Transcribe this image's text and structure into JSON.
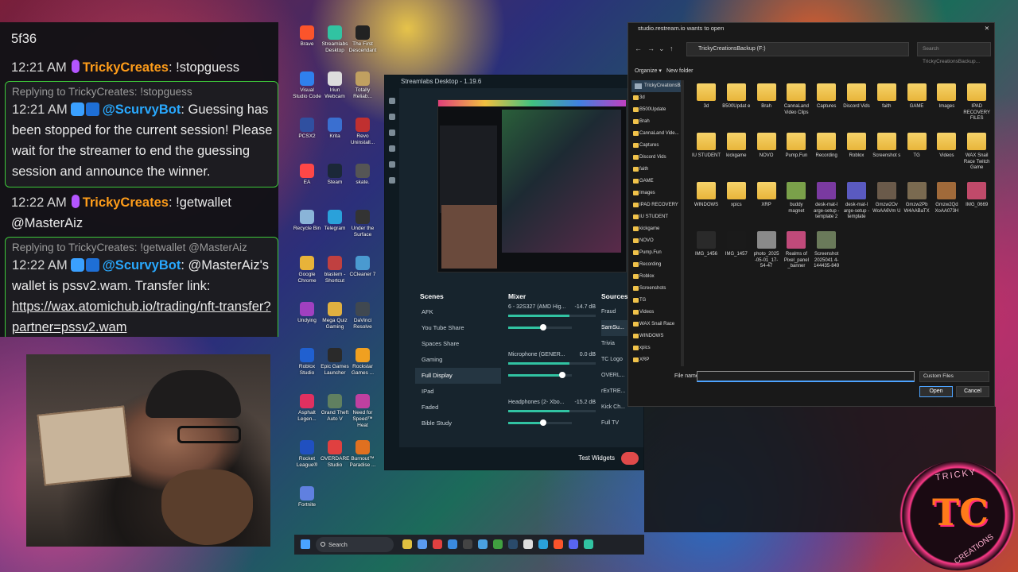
{
  "chat": {
    "top_fragment": "5f36",
    "messages": [
      {
        "type": "msg",
        "time": "12:21 AM",
        "user": "TrickyCreates",
        "text": ": !stopguess"
      },
      {
        "type": "reply",
        "reply_to": "Replying to TrickyCreates: !stopguess",
        "time": "12:21 AM",
        "user": "@ScurvyBot",
        "text": ": Guessing has been stopped for the current session! Please wait for the streamer to end the guessing session and announce the winner."
      },
      {
        "type": "msg",
        "time": "12:22 AM",
        "user": "TrickyCreates",
        "text": ": !getwallet @MasterAiz"
      },
      {
        "type": "reply",
        "reply_to": "Replying to TrickyCreates: !getwallet @MasterAiz",
        "time": "12:22 AM",
        "user": "@ScurvyBot",
        "text": ": @MasterAiz's wallet is pssv2.wam. Transfer link:",
        "link": "https://wax.atomichub.io/trading/nft-transfer?partner=pssv2.wam"
      }
    ]
  },
  "desktop_icons": [
    {
      "label": "Brave",
      "color": "#fb542b"
    },
    {
      "label": "Streamlabs Desktop",
      "color": "#31c3a2"
    },
    {
      "label": "The First Descendant",
      "color": "#222222"
    },
    {
      "label": "Visual Studio Code",
      "color": "#2f80ed"
    },
    {
      "label": "Iriun Webcam",
      "color": "#dddddd"
    },
    {
      "label": "Totally Reliab...",
      "color": "#c0a060"
    },
    {
      "label": "PCSX2",
      "color": "#3050a0"
    },
    {
      "label": "Krita",
      "color": "#3a6fd0"
    },
    {
      "label": "Revo Uninstall...",
      "color": "#c03030"
    },
    {
      "label": "EA",
      "color": "#ff4747"
    },
    {
      "label": "Steam",
      "color": "#1b2838"
    },
    {
      "label": "skate.",
      "color": "#555555"
    },
    {
      "label": "Recycle Bin",
      "color": "#8ab4d8"
    },
    {
      "label": "Telegram",
      "color": "#2aa1da"
    },
    {
      "label": "Under the Surface",
      "color": "#333333"
    },
    {
      "label": "Google Chrome",
      "color": "#e8b339"
    },
    {
      "label": "blastem - Shortcut",
      "color": "#c04040"
    },
    {
      "label": "CCleaner 7",
      "color": "#4a9ad0"
    },
    {
      "label": "Undying",
      "color": "#a040c0"
    },
    {
      "label": "Mega Quiz Gaming",
      "color": "#e0b040"
    },
    {
      "label": "DaVinci Resolve",
      "color": "#404850"
    },
    {
      "label": "Roblox Studio",
      "color": "#2060d0"
    },
    {
      "label": "Epic Games Launcher",
      "color": "#2a2a2a"
    },
    {
      "label": "Rockstar Games ...",
      "color": "#f0a020"
    },
    {
      "label": "Asphalt Legen...",
      "color": "#e03060"
    },
    {
      "label": "Grand Theft Auto V",
      "color": "#608060"
    },
    {
      "label": "Need for Speed™ Heat",
      "color": "#c040a0"
    },
    {
      "label": "Rocket League®",
      "color": "#2050c0"
    },
    {
      "label": "OVERDARE Studio",
      "color": "#e04040"
    },
    {
      "label": "Burnout™ Paradise ...",
      "color": "#e07020"
    },
    {
      "label": "Fortnite",
      "color": "#6080e0"
    }
  ],
  "streamlabs": {
    "title": "Streamlabs Desktop - 1.19.6",
    "scenes_label": "Scenes",
    "mixer_label": "Mixer",
    "sources_label": "Sources",
    "scenes": [
      "AFK",
      "You Tube Share",
      "Spaces Share",
      "Gaming",
      "Full Display",
      "IPad",
      "Faded",
      "Bible Study"
    ],
    "active_scene": "Full Display",
    "mixer": [
      {
        "name": "6 - 32S327 (AMD Hig...",
        "db": "-14.7 dB",
        "level": 0.55
      },
      {
        "name": "Microphone (GENER...",
        "db": "0.0 dB",
        "level": 0.85
      },
      {
        "name": "Headphones (2- Xbo...",
        "db": "-15.2 dB",
        "level": 0.55
      }
    ],
    "sources": [
      "Fraud",
      "SamSu...",
      "Trivia",
      "TC Logo",
      "OVERL...",
      "rExTRE...",
      "Kick Ch...",
      "Full TV"
    ],
    "active_source": "SamSu...",
    "test_widgets": "Test Widgets"
  },
  "dialog": {
    "title": "studio.restream.io wants to open",
    "address": "TrickyCreationsBackup (F:)",
    "search_placeholder": "Search TrickyCreationsBackup...",
    "organize": "Organize ▾",
    "new_folder": "New folder",
    "tree_root": "TrickyCreationsBa...",
    "tree": [
      "3d",
      "B500Update",
      "Brah",
      "CannaLand Vide...",
      "Captures",
      "Discord Vids",
      "faith",
      "GAME",
      "Images",
      "IPAD RECOVERY",
      "IU STUDENT",
      "kickgame",
      "NOVO",
      "Pump.Fun",
      "Recording",
      "Roblox",
      "Screenshots",
      "TG",
      "Videos",
      "WAX Snail Race",
      "WINDOWS",
      "xpics",
      "XRP"
    ],
    "files": [
      {
        "name": "3d",
        "kind": "folder"
      },
      {
        "name": "B500Updat e",
        "kind": "folder"
      },
      {
        "name": "Brah",
        "kind": "folder"
      },
      {
        "name": "CannaLand Video Clips",
        "kind": "folder"
      },
      {
        "name": "Captures",
        "kind": "folder"
      },
      {
        "name": "Discord Vids",
        "kind": "folder"
      },
      {
        "name": "faith",
        "kind": "folder"
      },
      {
        "name": "GAME",
        "kind": "folder"
      },
      {
        "name": "Images",
        "kind": "folder"
      },
      {
        "name": "IPAD RECOVERY FILES",
        "kind": "folder"
      },
      {
        "name": "IU STUDENT",
        "kind": "folder"
      },
      {
        "name": "kickgame",
        "kind": "folder"
      },
      {
        "name": "NOVO",
        "kind": "folder"
      },
      {
        "name": "Pump.Fun",
        "kind": "folder"
      },
      {
        "name": "Recording",
        "kind": "folder"
      },
      {
        "name": "Roblox",
        "kind": "folder"
      },
      {
        "name": "Screenshot s",
        "kind": "folder"
      },
      {
        "name": "TG",
        "kind": "folder"
      },
      {
        "name": "Videos",
        "kind": "folder"
      },
      {
        "name": "WAX Snail Race Twitch Game",
        "kind": "folder"
      },
      {
        "name": "WINDOWS",
        "kind": "folder"
      },
      {
        "name": "xpics",
        "kind": "folder"
      },
      {
        "name": "XRP",
        "kind": "folder"
      },
      {
        "name": "buddy magnet",
        "kind": "image",
        "color": "#7aa04a"
      },
      {
        "name": "desk-mat-l arge-setup -template 2",
        "kind": "image",
        "color": "#7a3aa0"
      },
      {
        "name": "desk-mat-l arge-setup -template",
        "kind": "image",
        "color": "#5a5ac0"
      },
      {
        "name": "Gmzw2Ov WoAA6Vm U",
        "kind": "image",
        "color": "#6a5a4a"
      },
      {
        "name": "Gmzw2Pb W4AABaTX",
        "kind": "image",
        "color": "#7a6a50"
      },
      {
        "name": "Gmzw2Qd XoAA073H",
        "kind": "image",
        "color": "#a06a3a"
      },
      {
        "name": "IMG_0669",
        "kind": "image",
        "color": "#c04a6a"
      },
      {
        "name": "IMG_1456",
        "kind": "image",
        "color": "#2a2a2a"
      },
      {
        "name": "IMG_1457",
        "kind": "image",
        "color": "#1a1a1a"
      },
      {
        "name": "photo_2025 -05-01_17- 54-47",
        "kind": "image",
        "color": "#8a8a8a"
      },
      {
        "name": "Realms of Pixel_panel _banner",
        "kind": "image",
        "color": "#c04a7a"
      },
      {
        "name": "Screenshot 2025041 4-144435-849",
        "kind": "image",
        "color": "#6a7a5a"
      }
    ],
    "file_name_label": "File name:",
    "file_name_value": "",
    "filter": "Custom Files",
    "open": "Open",
    "cancel": "Cancel"
  },
  "taskbar": {
    "search": "Search",
    "icons": [
      {
        "name": "dog-app-icon",
        "color": "#e0c040"
      },
      {
        "name": "copilot-icon",
        "color": "#5a9af0"
      },
      {
        "name": "roblox-icon",
        "color": "#e04040"
      },
      {
        "name": "files-icon",
        "color": "#3a8ae0"
      },
      {
        "name": "terminal-icon",
        "color": "#444444"
      },
      {
        "name": "notepad-icon",
        "color": "#4aa0e0"
      },
      {
        "name": "chrome-icon",
        "color": "#40a040"
      },
      {
        "name": "steam-icon",
        "color": "#2a4a6a"
      },
      {
        "name": "app-icon",
        "color": "#dddddd"
      },
      {
        "name": "telegram-icon",
        "color": "#2aa1da"
      },
      {
        "name": "brave-icon",
        "color": "#fb542b"
      },
      {
        "name": "discord-icon",
        "color": "#5865f2"
      },
      {
        "name": "streamlabs-icon",
        "color": "#31c3a2"
      }
    ]
  },
  "logo": {
    "top_text": "TRICKY",
    "monogram": "TC",
    "bottom_text": "CREATIONS"
  }
}
